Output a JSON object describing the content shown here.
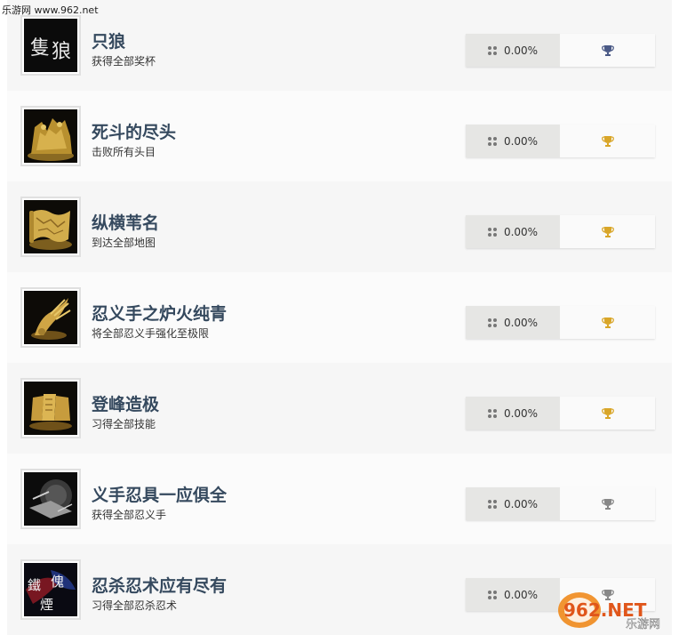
{
  "watermark_top": "乐游网 www.962.net",
  "watermark_bottom": {
    "brand": "962.NET",
    "tagline": "乐游网"
  },
  "colors": {
    "bronze": "#4b5a86",
    "gold": "#d9a629",
    "silver": "#888888"
  },
  "achievements": [
    {
      "title": "只狼",
      "description": "获得全部奖杯",
      "percent": "0.00%",
      "trophy": "bronze",
      "icon": "sekiro-calligraphy-icon"
    },
    {
      "title": "死斗的尽头",
      "description": "击败所有头目",
      "percent": "0.00%",
      "trophy": "gold",
      "icon": "golden-bosses-icon"
    },
    {
      "title": "纵横苇名",
      "description": "到达全部地图",
      "percent": "0.00%",
      "trophy": "gold",
      "icon": "golden-map-icon"
    },
    {
      "title": "忍义手之炉火纯青",
      "description": "将全部忍义手强化至极限",
      "percent": "0.00%",
      "trophy": "gold",
      "icon": "golden-prosthetic-icon"
    },
    {
      "title": "登峰造极",
      "description": "习得全部技能",
      "percent": "0.00%",
      "trophy": "gold",
      "icon": "golden-scrolls-icon"
    },
    {
      "title": "义手忍具一应俱全",
      "description": "获得全部忍义手",
      "percent": "0.00%",
      "trophy": "silver",
      "icon": "prosthetic-tools-icon"
    },
    {
      "title": "忍杀忍术应有尽有",
      "description": "习得全部忍杀忍术",
      "percent": "0.00%",
      "trophy": "silver",
      "icon": "ninjutsu-calligraphy-icon"
    }
  ]
}
